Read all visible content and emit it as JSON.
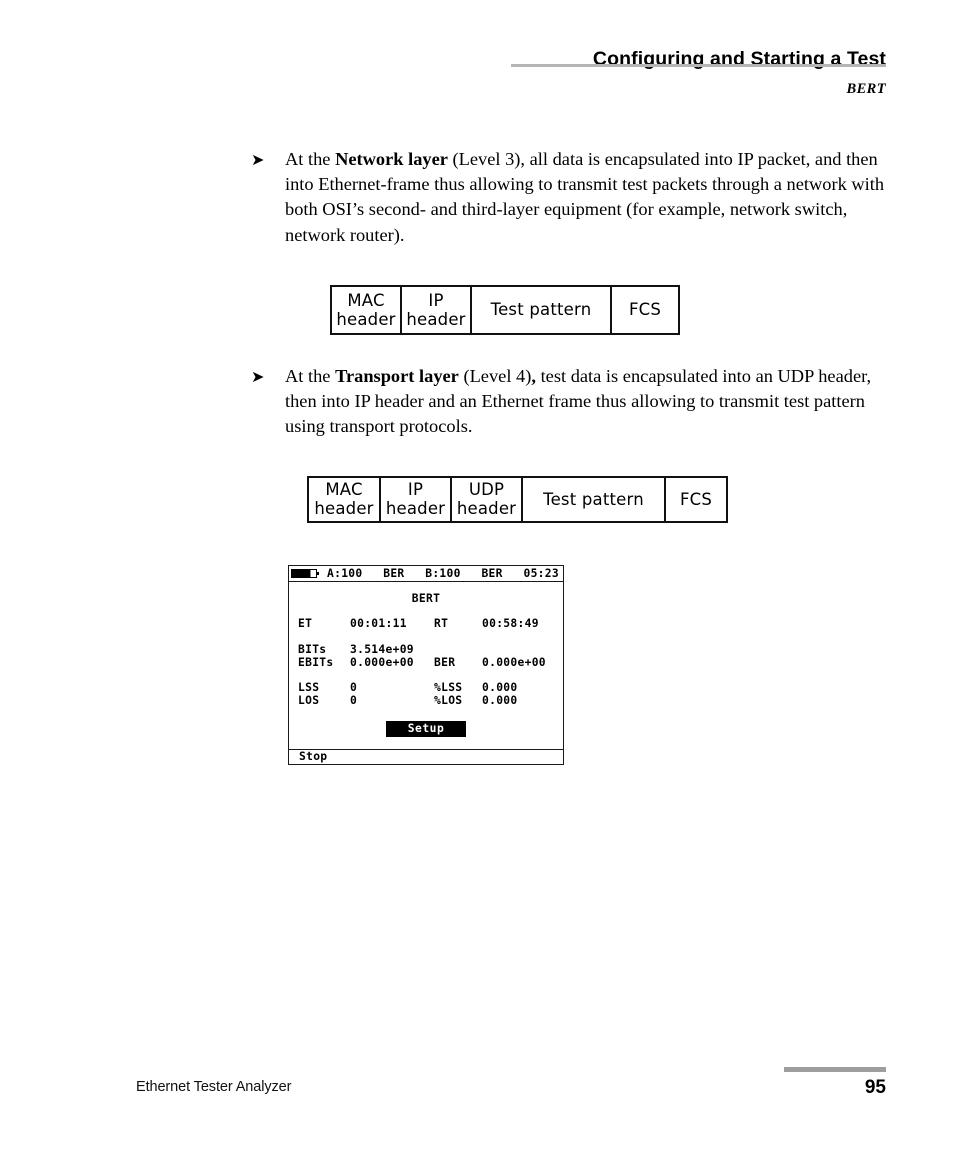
{
  "header": {
    "title": "Configuring and Starting a Test",
    "subtitle": "BERT"
  },
  "body": {
    "bullet_glyph": "➤",
    "paragraphs": [
      {
        "lead": "At the ",
        "bold": "Network layer",
        "rest": " (Level 3), all data is encapsulated into IP packet, and then into Ethernet-frame thus allowing to transmit test packets through a network with both OSI’s second- and third-layer equipment (for example, network switch, network router)."
      },
      {
        "lead": "At the ",
        "bold": "Transport layer",
        "mid": " (Level 4)",
        "bold2": ",",
        "rest": " test data is encapsulated into an UDP header, then into IP header and an Ethernet frame thus allowing to transmit test pattern using transport protocols."
      }
    ]
  },
  "diagrams": [
    {
      "name": "network-layer-frame",
      "cells": [
        {
          "line1": "MAC",
          "line2": "header"
        },
        {
          "line1": "IP",
          "line2": "header"
        },
        {
          "line1": "Test pattern",
          "line2": ""
        },
        {
          "line1": "FCS",
          "line2": ""
        }
      ]
    },
    {
      "name": "transport-layer-frame",
      "cells": [
        {
          "line1": "MAC",
          "line2": "header"
        },
        {
          "line1": "IP",
          "line2": "header"
        },
        {
          "line1": "UDP",
          "line2": "header"
        },
        {
          "line1": "Test pattern",
          "line2": ""
        },
        {
          "line1": "FCS",
          "line2": ""
        }
      ]
    }
  ],
  "lcd": {
    "statusbar": {
      "battery": "battery-full-icon",
      "port_a": "A:100",
      "mode_a": "BER",
      "port_b": "B:100",
      "mode_b": "BER",
      "clock": "05:23"
    },
    "title": "BERT",
    "rows": [
      {
        "k1": "ET",
        "v1": "00:01:11",
        "k2": "RT",
        "v2": "00:58:49"
      },
      {
        "k1": "BITs",
        "v1": "3.514e+09",
        "k2": "",
        "v2": ""
      },
      {
        "k1": "EBITs",
        "v1": "0.000e+00",
        "k2": "BER",
        "v2": "0.000e+00"
      },
      {
        "k1": "LSS",
        "v1": "0",
        "k2": "%LSS",
        "v2": "0.000"
      },
      {
        "k1": "LOS",
        "v1": "0",
        "k2": "%LOS",
        "v2": "0.000"
      }
    ],
    "setup_button": "Setup",
    "soft_key": "Stop"
  },
  "footer": {
    "document_name": "Ethernet Tester Analyzer",
    "page_number": "95"
  },
  "colors": {
    "rule_gray": "#b5b5b5",
    "footer_rule_gray": "#9e9e9e",
    "ink": "#000000"
  }
}
